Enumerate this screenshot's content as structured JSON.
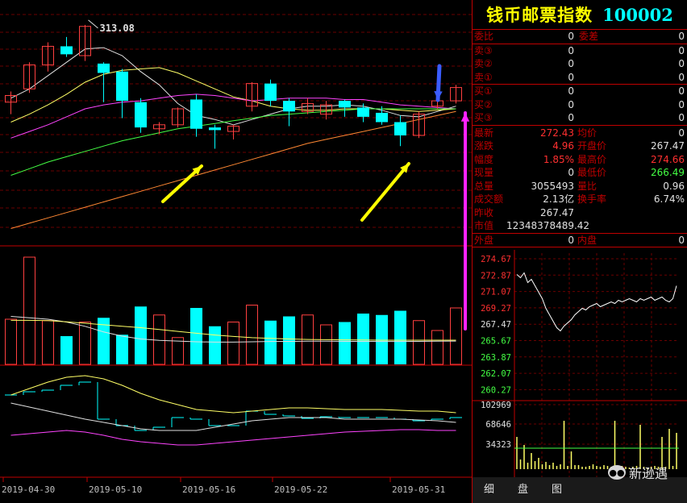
{
  "header": {
    "name": "钱币邮票指数",
    "code": "100002"
  },
  "order_book": {
    "ratio_label": "委比",
    "ratio_value": "0",
    "diff_label": "委差",
    "diff_value": "0",
    "asks": [
      {
        "label": "卖③",
        "price": "0",
        "volume": "0"
      },
      {
        "label": "卖②",
        "price": "0",
        "volume": "0"
      },
      {
        "label": "卖①",
        "price": "0",
        "volume": "0"
      }
    ],
    "bids": [
      {
        "label": "买①",
        "price": "0",
        "volume": "0"
      },
      {
        "label": "买②",
        "price": "0",
        "volume": "0"
      },
      {
        "label": "买③",
        "price": "0",
        "volume": "0"
      }
    ]
  },
  "quote": {
    "latest_label": "最新",
    "latest": "272.43",
    "avg_label": "均价",
    "avg": "0",
    "change_label": "涨跌",
    "change": "4.96",
    "open_label": "开盘价",
    "open": "267.47",
    "pct_label": "幅度",
    "pct": "1.85%",
    "high_label": "最高价",
    "high": "274.66",
    "cur_vol_label": "现量",
    "cur_vol": "0",
    "low_label": "最低价",
    "low": "266.49",
    "total_vol_label": "总量",
    "total_vol": "3055493",
    "vol_ratio_label": "量比",
    "vol_ratio": "0.96",
    "amount_label": "成交额",
    "amount": "2.13亿",
    "turnover_label": "换手率",
    "turnover": "6.74%",
    "prev_close_label": "昨收",
    "prev_close": "267.47",
    "mkt_cap_label": "市值",
    "mkt_cap": "12348378489.42",
    "outer_label": "外盘",
    "outer": "0",
    "inner_label": "内盘",
    "inner": "0"
  },
  "mini_chart": {
    "price_ticks": [
      "274.67",
      "272.87",
      "271.07",
      "269.27",
      "267.47",
      "265.67",
      "263.87",
      "262.07",
      "260.27"
    ],
    "volume_ticks": [
      "102969",
      "68646",
      "34323"
    ]
  },
  "tabs": [
    "细",
    "盘",
    "图"
  ],
  "watermark": "新逊遇",
  "main_chart": {
    "peak_label": "313.08",
    "dates": [
      "2019-04-30",
      "2019-05-10",
      "2019-05-16",
      "2019-05-22",
      "2019-05-31"
    ]
  },
  "chart_data": {
    "type": "candlestick",
    "candles": [
      {
        "o": 255,
        "h": 263,
        "l": 246,
        "c": 260
      },
      {
        "o": 265,
        "h": 285,
        "l": 262,
        "c": 283
      },
      {
        "o": 283,
        "h": 300,
        "l": 278,
        "c": 297
      },
      {
        "o": 297,
        "h": 304,
        "l": 289,
        "c": 291
      },
      {
        "o": 290,
        "h": 313.08,
        "l": 286,
        "c": 312
      },
      {
        "o": 284,
        "h": 285,
        "l": 255,
        "c": 277
      },
      {
        "o": 278,
        "h": 280,
        "l": 243,
        "c": 256
      },
      {
        "o": 255,
        "h": 258,
        "l": 232,
        "c": 236
      },
      {
        "o": 235,
        "h": 240,
        "l": 231,
        "c": 238
      },
      {
        "o": 238,
        "h": 251,
        "l": 236,
        "c": 250
      },
      {
        "o": 257,
        "h": 261,
        "l": 229,
        "c": 235
      },
      {
        "o": 236,
        "h": 238,
        "l": 220,
        "c": 234
      },
      {
        "o": 233,
        "h": 238,
        "l": 227,
        "c": 237
      },
      {
        "o": 252,
        "h": 270,
        "l": 248,
        "c": 269
      },
      {
        "o": 269,
        "h": 272,
        "l": 252,
        "c": 256
      },
      {
        "o": 256,
        "h": 258,
        "l": 237,
        "c": 248
      },
      {
        "o": 248,
        "h": 258,
        "l": 246,
        "c": 254
      },
      {
        "o": 246,
        "h": 256,
        "l": 242,
        "c": 253
      },
      {
        "o": 256,
        "h": 257,
        "l": 244,
        "c": 251
      },
      {
        "o": 251,
        "h": 254,
        "l": 240,
        "c": 244
      },
      {
        "o": 247,
        "h": 252,
        "l": 238,
        "c": 240
      },
      {
        "o": 240,
        "h": 245,
        "l": 222,
        "c": 230
      },
      {
        "o": 230,
        "h": 248,
        "l": 228,
        "c": 246
      },
      {
        "o": 252,
        "h": 258,
        "l": 250,
        "c": 256
      },
      {
        "o": 256,
        "h": 268,
        "l": 254,
        "c": 266
      }
    ],
    "volume": [
      160,
      380,
      155,
      100,
      150,
      165,
      105,
      205,
      175,
      95,
      200,
      135,
      150,
      210,
      155,
      170,
      175,
      140,
      150,
      180,
      175,
      190,
      155,
      120,
      200
    ],
    "ma": [
      {
        "color": "#e0e0e0",
        "values": [
          258,
          265,
          275,
          285,
          295,
          296,
          290,
          278,
          268,
          254,
          245,
          242,
          238,
          242,
          246,
          250,
          252,
          252,
          253,
          252,
          249,
          245,
          244,
          248,
          252
        ]
      },
      {
        "color": "#ffff66",
        "values": [
          240,
          246,
          253,
          261,
          270,
          276,
          279,
          280,
          281,
          277,
          271,
          265,
          259,
          256,
          252,
          250,
          249,
          249,
          250,
          250,
          250,
          249,
          248,
          249,
          250
        ]
      },
      {
        "color": "#ff44ff",
        "values": [
          228,
          233,
          238,
          244,
          250,
          253,
          255,
          256,
          258,
          260,
          261,
          260,
          258,
          256,
          257,
          258,
          258,
          258,
          257,
          257,
          255,
          253,
          252,
          251,
          250
        ]
      },
      {
        "color": "#44ff44",
        "values": [
          200,
          205,
          210,
          214,
          218,
          222,
          226,
          229,
          232,
          235,
          237,
          239,
          241,
          243,
          245,
          246,
          247,
          248,
          249,
          250,
          250,
          250,
          250,
          250,
          250
        ]
      },
      {
        "color": "#ff8833",
        "values": [
          160,
          164,
          168,
          172,
          176,
          180,
          184,
          188,
          192,
          196,
          200,
          204,
          208,
          212,
          216,
          220,
          224,
          227,
          230,
          233,
          236,
          239,
          242,
          245,
          248
        ]
      }
    ]
  }
}
